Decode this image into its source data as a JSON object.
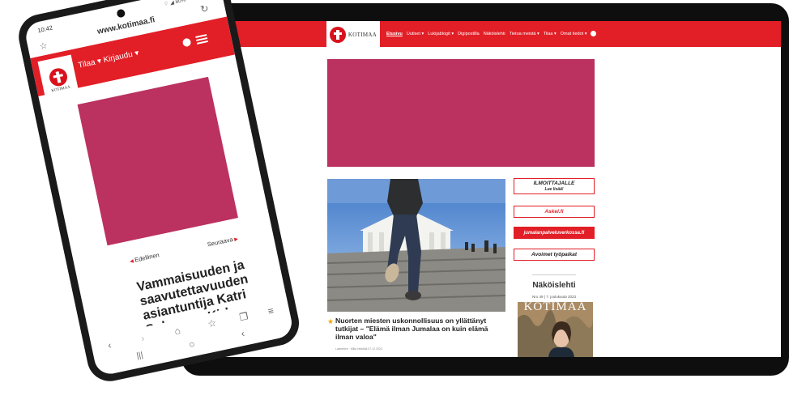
{
  "tablet": {
    "brand": "KOTIMAA",
    "menu": [
      "Etusivu",
      "Uutiset ▾",
      "Lukijablogit ▾",
      "Digipostilla",
      "Näköislehti",
      "Tietoa meistä ▾",
      "Tilaa ▾",
      "Omat tiedot ▾"
    ],
    "article": {
      "headline": "Nuorten miesten uskonnollisuus on yllättänyt tutkijat – \"Elämä ilman Jumalaa on kuin elämä ilman valoa\"",
      "meta": "Lakeimies · Milla Heikkilä 07.12.2023"
    },
    "sidebar": {
      "ilmoittajalle": "ILMOITTAJALLE",
      "lue_lisaa": "Lue lisää!",
      "askel": "Askel.fi",
      "jumalanpalvelus": "jumalanpalveluverkossa.fi",
      "avoimet": "Avoimet työpaikat",
      "nakoislehti_title": "Näköislehti",
      "nakoislehti_date": "Nro 49 | 7. joulukuuta 2023",
      "cover_masthead": "KOTIMAA"
    },
    "colors": {
      "brand_red": "#e21e26",
      "ad_magenta": "#bb3160"
    }
  },
  "phone": {
    "status_time": "10:42",
    "status_right": "⌔ ◢ 80%",
    "url": "www.kotimaa.fi",
    "brand": "KOTIMAA",
    "menu": "Tilaa ▾  Kirjaudu ▾",
    "prev": "Edellinen",
    "next": "Seuraava",
    "article_title": "Vammaisuuden ja saavutettavuuden asiantuntija Katri Suhonen: Kirkon"
  }
}
